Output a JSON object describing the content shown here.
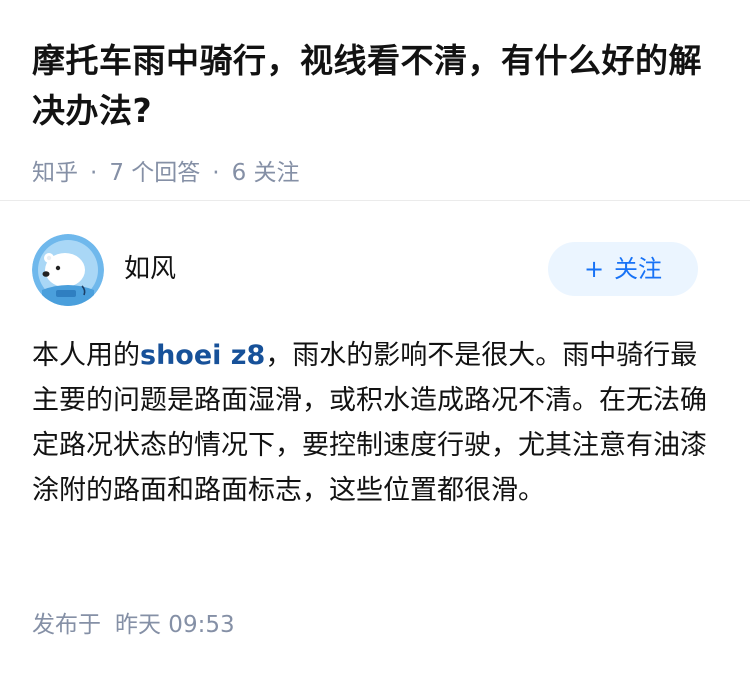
{
  "question": {
    "title": "摩托车雨中骑行，视线看不清，有什么好的解决办法?",
    "source": "知乎",
    "answer_count": "7 个回答",
    "follow_count": "6 关注",
    "separator": "·"
  },
  "answer": {
    "author": {
      "name": "如风",
      "avatar_icon": "polar-bear-avatar-icon",
      "follow_label": "关注",
      "follow_icon": "plus-icon"
    },
    "text_before_link": "本人用的",
    "link_text": "shoei z8",
    "text_after_link": "，雨水的影响不是很大。雨中骑行最主要的问题是路面湿滑，或积水造成路况不清。在无法确定路况状态的情况下，要控制速度行驶，尤其注意有油漆涂附的路面和路面标志，这些位置都很滑。",
    "publish_label": "发布于",
    "publish_time": "昨天 09:53"
  },
  "colors": {
    "title": "#121212",
    "meta": "#8590a6",
    "link": "#175199",
    "follow_text": "#1772f6",
    "follow_bg": "#ebf5ff",
    "avatar_bg": "#6fb8ec"
  }
}
